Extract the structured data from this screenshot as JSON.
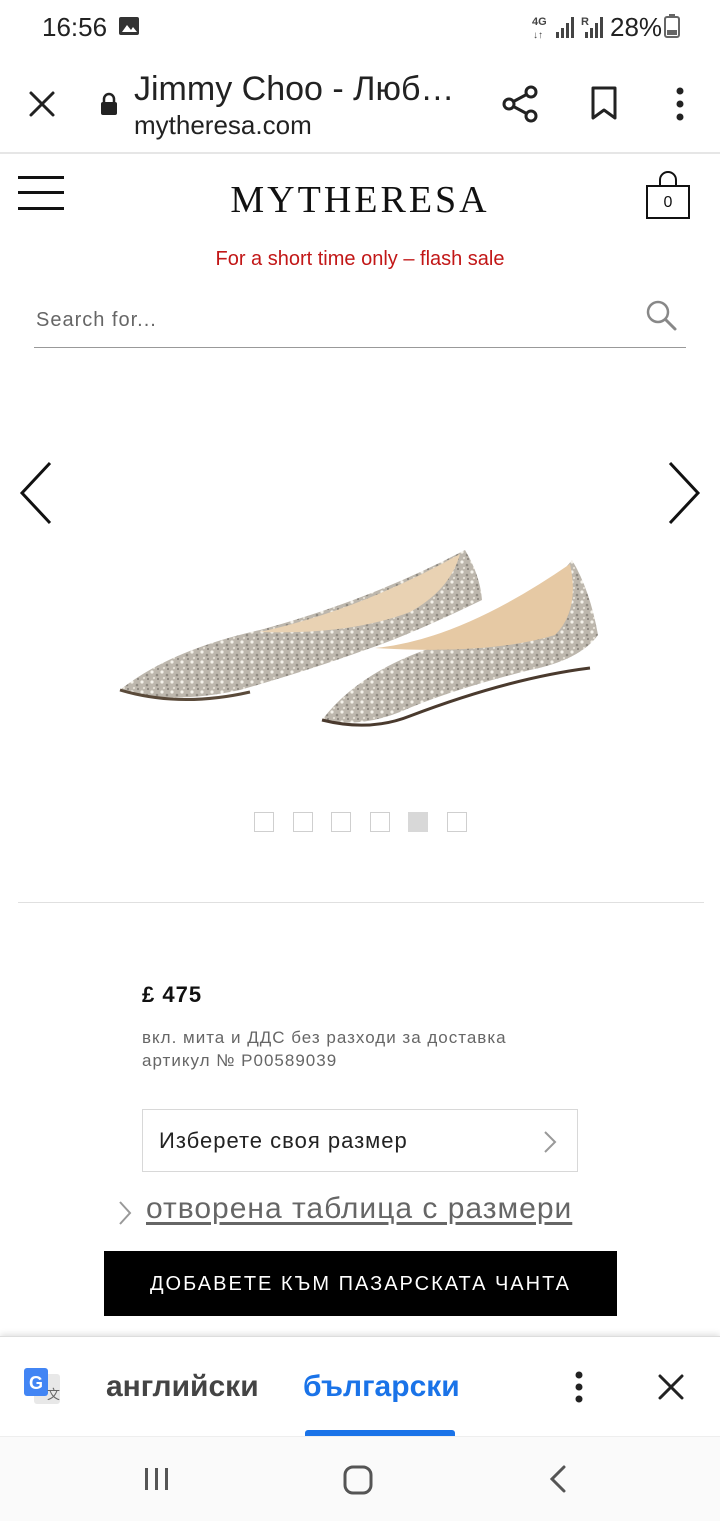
{
  "status_bar": {
    "time": "16:56",
    "network": "4G",
    "roaming": "R",
    "battery": "28%"
  },
  "browser": {
    "page_title": "Jimmy Choo - Люб…",
    "domain": "mytheresa.com"
  },
  "site": {
    "logo": "MYTHERESA",
    "cart_count": "0",
    "promo": "For a short time only – flash sale",
    "search_placeholder": "Search for..."
  },
  "gallery": {
    "image_count": 6,
    "active_index": 4
  },
  "product": {
    "price": "£ 475",
    "duties_note": "вкл. мита и ДДС без разходи за доставка",
    "sku": "артикул № P00589039",
    "size_select_label": "Изберете своя размер",
    "size_chart_link": "отворена таблица с размери",
    "add_to_bag": "ДОБАВЕТЕ КЪМ ПАЗАРСКАТА ЧАНТА"
  },
  "translate_bar": {
    "source_language": "английски",
    "target_language": "български",
    "active": "target"
  },
  "colors": {
    "promo_red": "#c21717",
    "translate_blue": "#1a73e8",
    "button_black": "#000000"
  }
}
